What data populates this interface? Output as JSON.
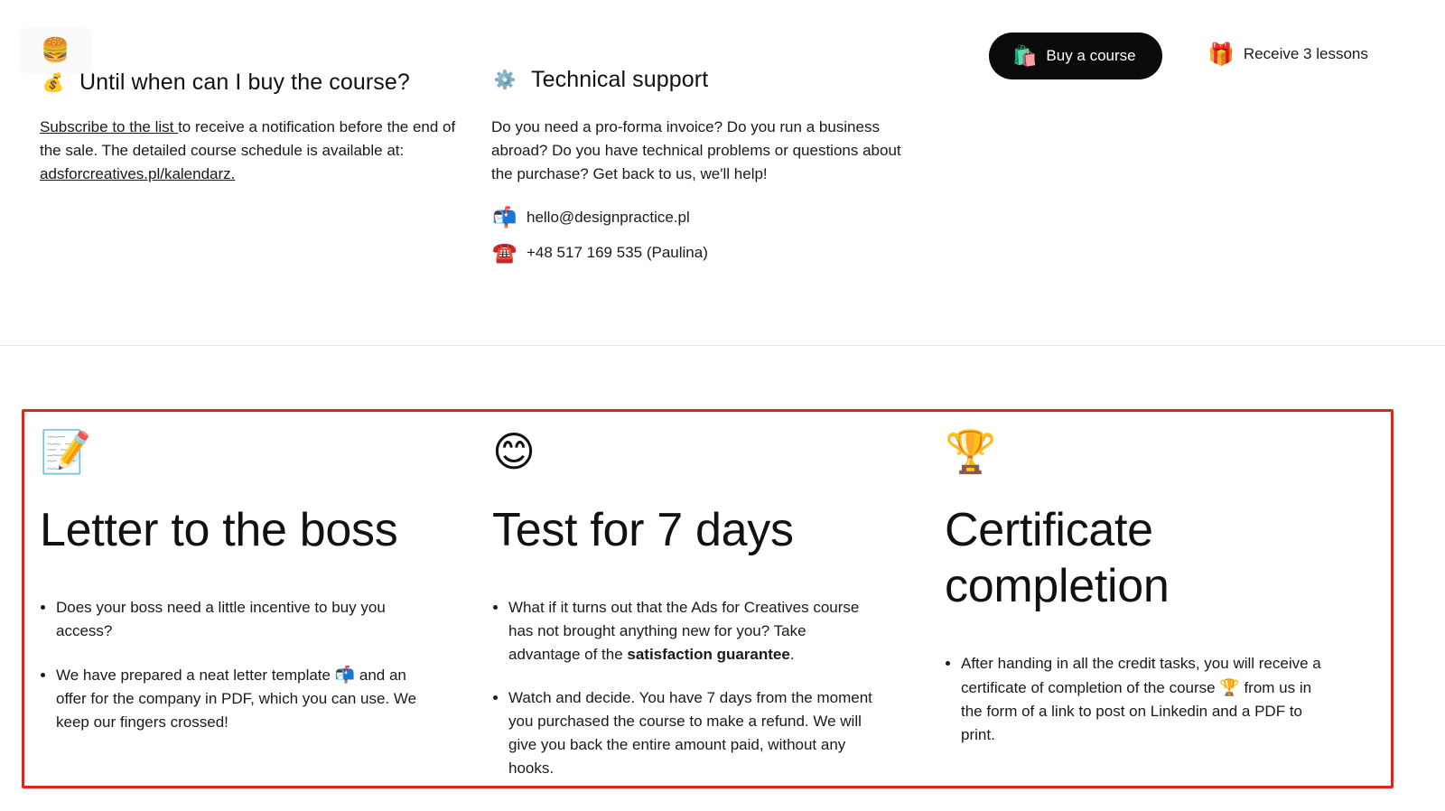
{
  "header": {
    "burger_icon": "🍔",
    "buy_button": {
      "icon": "🛍️",
      "label": "Buy a course"
    },
    "lessons_link": {
      "icon": "🎁",
      "label": "Receive 3 lessons"
    }
  },
  "purchase_info": {
    "icon": "💰",
    "title": "Until when can I buy the course?",
    "subscribe_link": "Subscribe to the list ",
    "text_after_link": "to receive a notification before the end of the sale. The detailed course schedule is available at:",
    "calendar_link": "adsforcreatives.pl/kalendarz."
  },
  "support": {
    "icon": "⚙️",
    "title": "Technical support",
    "text": "Do you need a pro-forma invoice? Do you run a business abroad? Do you have technical problems or questions about the purchase? Get back to us, we'll help!",
    "email_icon": "📬",
    "email": "hello@designpractice.pl",
    "phone_icon": "☎️",
    "phone": "+48 517 169 535 (Paulina)"
  },
  "features": [
    {
      "icon": "📝",
      "title": "Letter to the boss",
      "bullets": [
        {
          "text": "Does your boss need a little incentive to buy you access?"
        },
        {
          "before": "We have prepared a neat letter template ",
          "emoji": "📬",
          "after": " and an offer for the company in PDF, which you can use. We keep our fingers crossed!"
        }
      ]
    },
    {
      "icon": "😊",
      "title": "Test for 7 days",
      "bullets": [
        {
          "before": "What if it turns out that the Ads for Creatives course has not brought anything new for you? Take advantage of the ",
          "bold": "satisfaction guarantee",
          "after": "."
        },
        {
          "text": "Watch and decide. You have 7 days from the moment you purchased the course to make a refund. We will give you back the entire amount paid, without any hooks."
        }
      ]
    },
    {
      "icon": "🏆",
      "title_line1": "Certificate",
      "title_line2": "completion",
      "bullets": [
        {
          "before": "After handing in all the credit tasks, you will receive a certificate of completion of the course ",
          "emoji": "🏆",
          "after": " from us in the form of a link to post on Linkedin and a PDF to print."
        }
      ]
    }
  ],
  "colors": {
    "highlight_border": "#e0261b",
    "button_bg": "#0b0b0b",
    "divider": "#e6e6e6"
  }
}
